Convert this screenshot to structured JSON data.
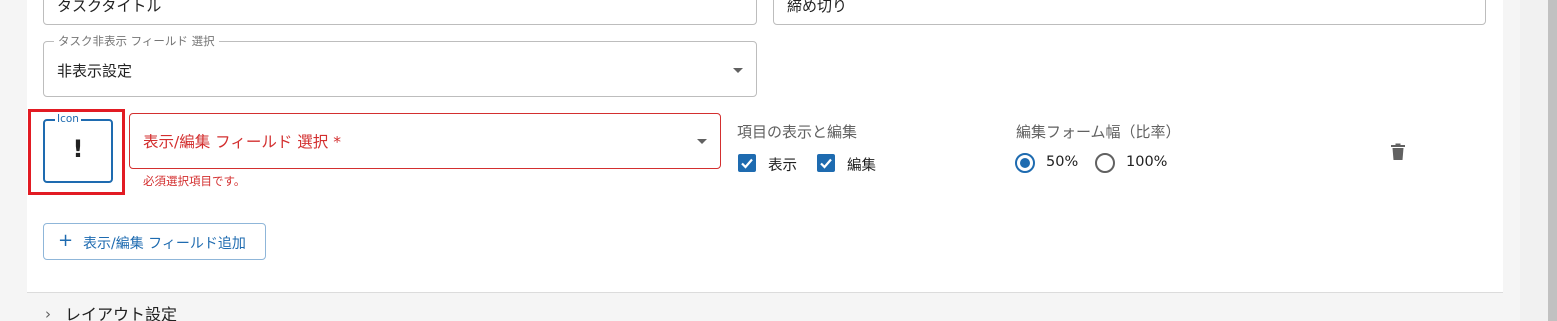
{
  "top_row": {
    "left_field_value": "タスクタイトル",
    "right_field_value": "締め切り"
  },
  "hide_field_select": {
    "label": "タスク非表示 フィールド 選択",
    "value": "非表示設定"
  },
  "field_row": {
    "icon_label": "Icon",
    "icon_glyph": "!",
    "display_edit_select": {
      "label": "表示/編集 フィールド 選択 *",
      "helper_text": "必須選択項目です。",
      "state": "error"
    },
    "visibility_group": {
      "label": "項目の表示と編集",
      "options": [
        {
          "label": "表示",
          "checked": true
        },
        {
          "label": "編集",
          "checked": true
        }
      ]
    },
    "width_group": {
      "label": "編集フォーム幅（比率）",
      "options": [
        {
          "label": "50%",
          "selected": true
        },
        {
          "label": "100%",
          "selected": false
        }
      ]
    },
    "delete_icon": "trash-icon"
  },
  "add_field_button": {
    "icon": "plus-icon",
    "label": "表示/編集 フィールド追加"
  },
  "layout_section": {
    "label": "レイアウト設定",
    "icon": "chevron-right-icon"
  },
  "colors": {
    "accent": "#1e6bb0",
    "error": "#d32f2f",
    "highlight": "#e21b23"
  }
}
